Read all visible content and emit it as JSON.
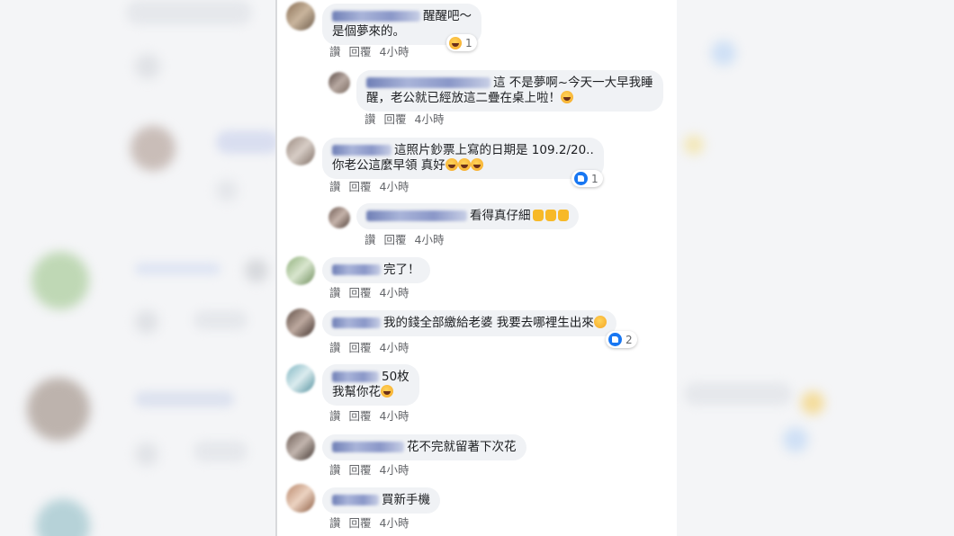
{
  "action_labels": {
    "like": "讚",
    "reply": "回覆",
    "time": "4小時"
  },
  "comments": [
    {
      "line1": "醒醒吧～",
      "line2": "是個夢來的。",
      "reaction_count": "1"
    },
    {
      "line1": "這 不是夢啊~今天一大早我睡",
      "line2": "醒，老公就已經放這二疊在桌上啦！"
    },
    {
      "line1": "這照片鈔票上寫的日期是 109.2/20..",
      "line2": "你老公這麼早領 真好",
      "reaction_count": "1"
    },
    {
      "line1": "看得真仔細"
    },
    {
      "line1": "完了！"
    },
    {
      "line1": "我的錢全部繳給老婆 我要去哪裡生出來",
      "reaction_count": "2"
    },
    {
      "line1": "50枚",
      "line2": "我幫你花"
    },
    {
      "line1": "花不完就留著下次花"
    },
    {
      "line1": "買新手機"
    }
  ],
  "colors": {
    "bubble": "#f0f2f5",
    "meta_text": "#65676b",
    "like_blue": "#1877f2",
    "emoji_yellow": "#f7b928"
  },
  "icons": [
    "laugh-emoji-icon",
    "like-icon",
    "thumbs-up-emoji-icon",
    "smile-emoji-icon"
  ]
}
